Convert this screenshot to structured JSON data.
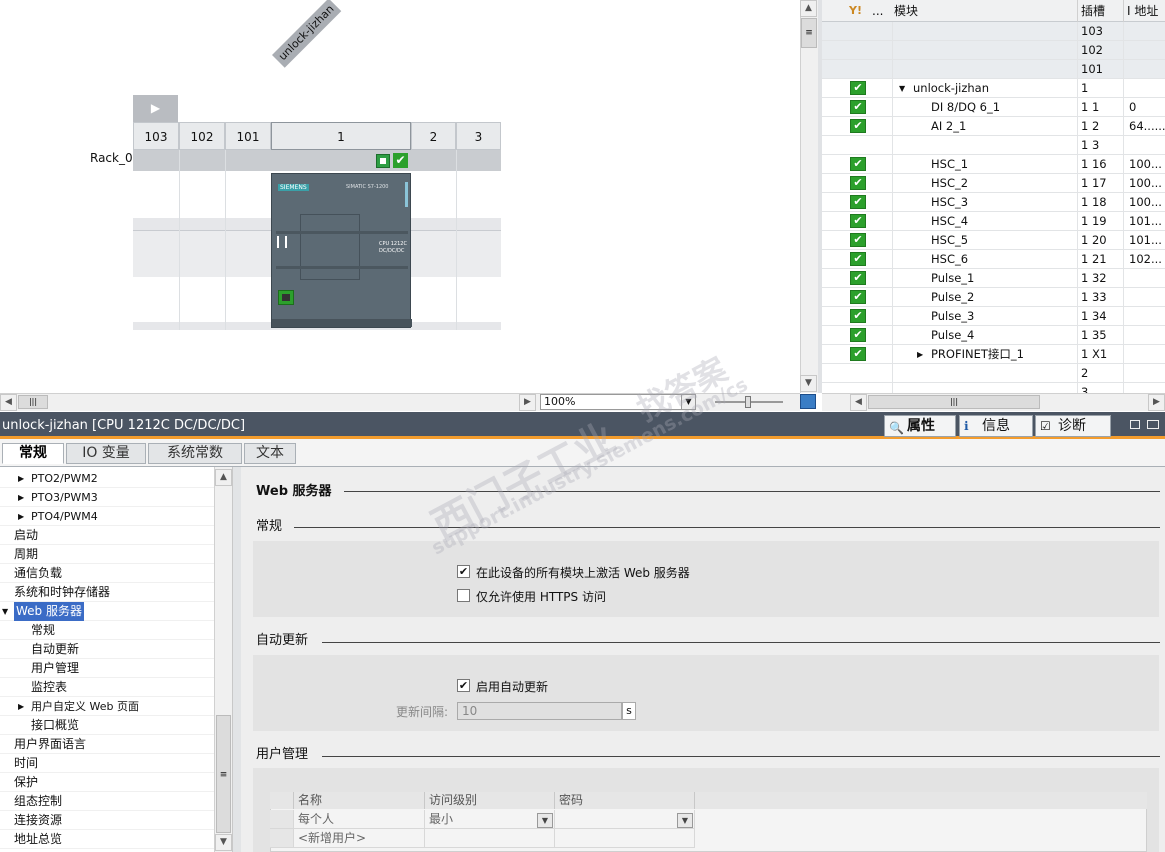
{
  "device": {
    "rack_tag": "unlock-jizhan",
    "rack_label": "Rack_0",
    "slots": [
      "103",
      "102",
      "101",
      "1",
      "2",
      "3"
    ],
    "cpu_brand": "SIEMENS",
    "cpu_line": "SIMATIC S7-1200",
    "cpu_model_line1": "CPU 1212C",
    "cpu_model_line2": "DC/DC/DC",
    "zoom": "100%"
  },
  "table": {
    "headers": {
      "ellipsis": "...",
      "module": "模块",
      "slot": "插槽",
      "addr": "I 地址"
    },
    "rows": [
      {
        "check": false,
        "indent": 0,
        "module": "",
        "slot": "103",
        "addr": ""
      },
      {
        "check": false,
        "indent": 0,
        "module": "",
        "slot": "102",
        "addr": ""
      },
      {
        "check": false,
        "indent": 0,
        "module": "",
        "slot": "101",
        "addr": ""
      },
      {
        "check": true,
        "indent": 1,
        "expand": "▼",
        "module": "unlock-jizhan",
        "slot": "1",
        "addr": ""
      },
      {
        "check": true,
        "indent": 2,
        "module": "DI 8/DQ 6_1",
        "slot": "1 1",
        "addr": "0"
      },
      {
        "check": true,
        "indent": 2,
        "module": "AI 2_1",
        "slot": "1 2",
        "addr": "64......"
      },
      {
        "check": false,
        "indent": 2,
        "module": "",
        "slot": "1 3",
        "addr": ""
      },
      {
        "check": true,
        "indent": 2,
        "module": "HSC_1",
        "slot": "1 16",
        "addr": "100..."
      },
      {
        "check": true,
        "indent": 2,
        "module": "HSC_2",
        "slot": "1 17",
        "addr": "100..."
      },
      {
        "check": true,
        "indent": 2,
        "module": "HSC_3",
        "slot": "1 18",
        "addr": "100..."
      },
      {
        "check": true,
        "indent": 2,
        "module": "HSC_4",
        "slot": "1 19",
        "addr": "101..."
      },
      {
        "check": true,
        "indent": 2,
        "module": "HSC_5",
        "slot": "1 20",
        "addr": "101..."
      },
      {
        "check": true,
        "indent": 2,
        "module": "HSC_6",
        "slot": "1 21",
        "addr": "102..."
      },
      {
        "check": true,
        "indent": 2,
        "module": "Pulse_1",
        "slot": "1 32",
        "addr": ""
      },
      {
        "check": true,
        "indent": 2,
        "module": "Pulse_2",
        "slot": "1 33",
        "addr": ""
      },
      {
        "check": true,
        "indent": 2,
        "module": "Pulse_3",
        "slot": "1 34",
        "addr": ""
      },
      {
        "check": true,
        "indent": 2,
        "module": "Pulse_4",
        "slot": "1 35",
        "addr": ""
      },
      {
        "check": true,
        "indent": 2,
        "expand": "▶",
        "module": "PROFINET接口_1",
        "slot": "1 X1",
        "addr": ""
      },
      {
        "check": false,
        "indent": 0,
        "module": "",
        "slot": "2",
        "addr": ""
      },
      {
        "check": false,
        "indent": 0,
        "module": "",
        "slot": "3",
        "addr": ""
      }
    ]
  },
  "props": {
    "title": "unlock-jizhan [CPU 1212C DC/DC/DC]",
    "panel_tabs": [
      "属性",
      "信息",
      "诊断"
    ],
    "tabs": [
      "常规",
      "IO 变量",
      "系统常数",
      "文本"
    ],
    "nav": [
      {
        "label": "PTO2/PWM2",
        "level": 1,
        "arrow": "▶"
      },
      {
        "label": "PTO3/PWM3",
        "level": 1,
        "arrow": "▶"
      },
      {
        "label": "PTO4/PWM4",
        "level": 1,
        "arrow": "▶"
      },
      {
        "label": "启动",
        "level": 0
      },
      {
        "label": "周期",
        "level": 0
      },
      {
        "label": "通信负载",
        "level": 0
      },
      {
        "label": "系统和时钟存储器",
        "level": 0
      },
      {
        "label": "Web 服务器",
        "level": 0,
        "arrow": "▼",
        "selected": true
      },
      {
        "label": "常规",
        "level": 2
      },
      {
        "label": "自动更新",
        "level": 2
      },
      {
        "label": "用户管理",
        "level": 2
      },
      {
        "label": "监控表",
        "level": 2
      },
      {
        "label": "用户自定义 Web 页面",
        "level": 1,
        "arrow": "▶"
      },
      {
        "label": "接口概览",
        "level": 2
      },
      {
        "label": "用户界面语言",
        "level": 0
      },
      {
        "label": "时间",
        "level": 0
      },
      {
        "label": "保护",
        "level": 0
      },
      {
        "label": "组态控制",
        "level": 0
      },
      {
        "label": "连接资源",
        "level": 0
      },
      {
        "label": "地址总览",
        "level": 0
      }
    ],
    "main": {
      "heading": "Web 服务器",
      "general": "常规",
      "cb_activate": "在此设备的所有模块上激活 Web 服务器",
      "cb_https": "仅允许使用 HTTPS 访问",
      "auto_update": "自动更新",
      "cb_auto": "启用自动更新",
      "interval_label": "更新间隔:",
      "interval_value": "10",
      "interval_unit": "s",
      "user_mgmt": "用户管理",
      "user_cols": [
        "名称",
        "访问级别",
        "密码"
      ],
      "user_row": [
        "每个人",
        "最小"
      ],
      "new_user": "<新增用户>"
    }
  },
  "watermark": {
    "line1": "西门子工业",
    "line2": "找答案",
    "line3": "support.industry.siemens.com/cs"
  }
}
